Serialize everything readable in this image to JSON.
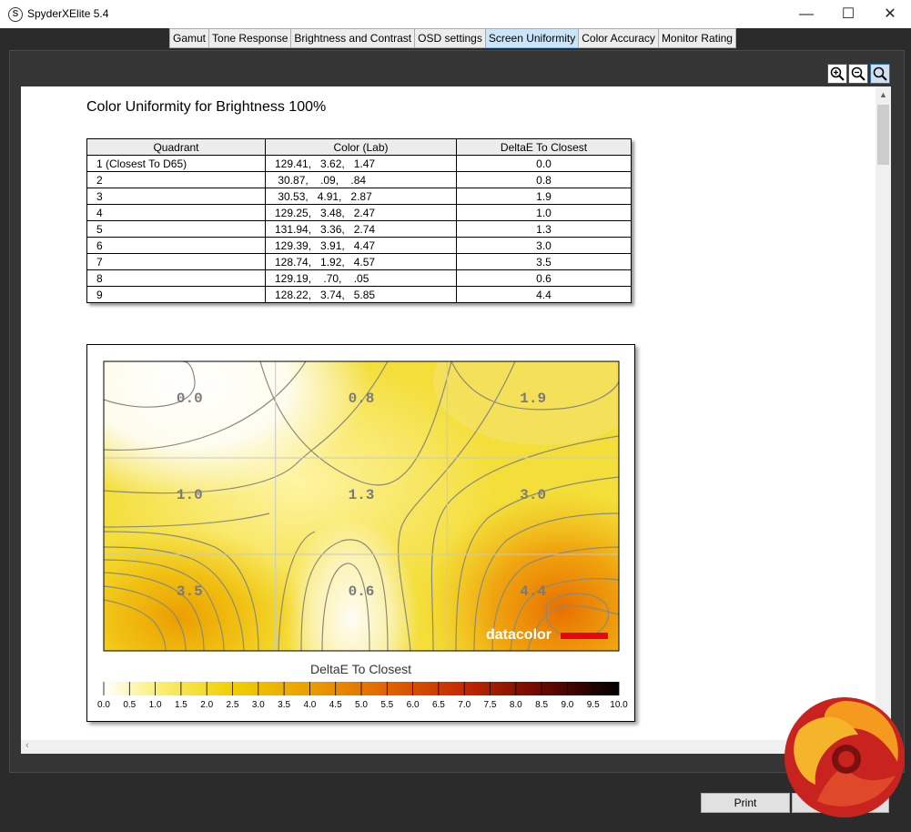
{
  "window": {
    "title": "SpyderXElite 5.4",
    "app_icon_letter": "S",
    "minimize_label": "—",
    "maximize_label": "☐",
    "close_label": "✕"
  },
  "tabs": [
    {
      "label": "Gamut"
    },
    {
      "label": "Tone Response"
    },
    {
      "label": "Brightness and Contrast"
    },
    {
      "label": "OSD settings"
    },
    {
      "label": "Screen Uniformity",
      "active": true
    },
    {
      "label": "Color Accuracy"
    },
    {
      "label": "Monitor Rating"
    }
  ],
  "zoom_tools": [
    {
      "icon": "zoom-in-icon"
    },
    {
      "icon": "zoom-out-icon"
    },
    {
      "icon": "zoom-fit-icon"
    }
  ],
  "report": {
    "title": "Color Uniformity for Brightness 100%",
    "table": {
      "headers": [
        "Quadrant",
        "Color (Lab)",
        "DeltaE To Closest"
      ],
      "rows": [
        [
          "1 (Closest To D65)",
          "129.41,   3.62,   1.47",
          "0.0"
        ],
        [
          "2",
          " 30.87,    .09,    .84",
          "0.8"
        ],
        [
          "3",
          " 30.53,   4.91,   2.87",
          "1.9"
        ],
        [
          "4",
          "129.25,   3.48,   2.47",
          "1.0"
        ],
        [
          "5",
          "131.94,   3.36,   2.74",
          "1.3"
        ],
        [
          "6",
          "129.39,   3.91,   4.47",
          "3.0"
        ],
        [
          "7",
          "128.74,   1.92,   4.57",
          "3.5"
        ],
        [
          "8",
          "129.19,    .70,    .05",
          "0.6"
        ],
        [
          "9",
          "128.22,   3.74,   5.85",
          "4.4"
        ]
      ]
    }
  },
  "chart_data": {
    "type": "heatmap",
    "grid_labels": [
      [
        "0.0",
        "0.8",
        "1.9"
      ],
      [
        "1.0",
        "1.3",
        "3.0"
      ],
      [
        "3.5",
        "0.6",
        "4.4"
      ]
    ],
    "grid_values": [
      [
        0.0,
        0.8,
        1.9
      ],
      [
        1.0,
        1.3,
        3.0
      ],
      [
        3.5,
        0.6,
        4.4
      ]
    ],
    "legend_title": "DeltaE To Closest",
    "scale_ticks": [
      "0.0",
      "0.5",
      "1.0",
      "1.5",
      "2.0",
      "2.5",
      "3.0",
      "3.5",
      "4.0",
      "4.5",
      "5.0",
      "5.5",
      "6.0",
      "6.5",
      "7.0",
      "7.5",
      "8.0",
      "8.5",
      "9.0",
      "9.5",
      "10.0"
    ],
    "scale_range": [
      0,
      10
    ],
    "watermark": "datacolor",
    "colors": {
      "low": "#ffffff",
      "mid": "#f0d000",
      "high": "#e86f00",
      "max": "#000000"
    }
  },
  "buttons": {
    "print": "Print"
  },
  "colors": {
    "tab_active": "#cce4f7",
    "background": "#2b2b2b"
  }
}
